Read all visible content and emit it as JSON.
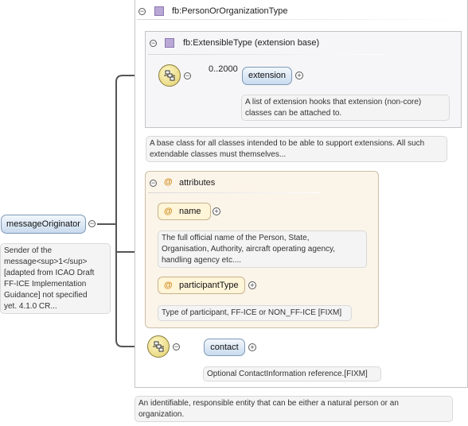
{
  "root": {
    "label": "messageOriginator",
    "doc": "Sender of the message<sup>1</sup> [adapted from ICAO Draft FF-ICE Implementation Guidance] not specified yet. 4.1.0 CR...",
    "doc_lines": [
      "Sender of the",
      "message<sup>1</sup>",
      "[adapted from ICAO Draft",
      "FF-ICE Implementation",
      "Guidance] not specified",
      "yet. 4.1.0 CR..."
    ]
  },
  "type": {
    "name": "fb:PersonOrOrganizationType",
    "doc_lines": [
      "An identifiable, responsible entity that can be either a natural person or an",
      "organization."
    ]
  },
  "base": {
    "name": "fb:ExtensibleType (extension base)",
    "doc_lines": [
      "A base class for all classes intended to be able to support extensions. All such",
      "extendable classes must themselves..."
    ]
  },
  "extension": {
    "cardinality": "0..2000",
    "label": "extension",
    "doc_lines": [
      "A list of extension hooks that extension (non-core)",
      "classes can be attached to."
    ]
  },
  "attributes": {
    "title": "attributes",
    "items": [
      {
        "label": "name",
        "doc_lines": [
          "The full official name of the Person, State,",
          "Organisation, Authority, aircraft operating agency,",
          "handling agency etc...."
        ]
      },
      {
        "label": "participantType",
        "doc_lines": [
          "Type of participant, FF-ICE or NON_FF-ICE [FIXM]"
        ]
      }
    ]
  },
  "contact": {
    "label": "contact",
    "doc_lines": [
      "Optional ContactInformation reference.[FIXM]"
    ]
  },
  "symbols": {
    "at": "@",
    "minus": "−",
    "plus": "+"
  }
}
